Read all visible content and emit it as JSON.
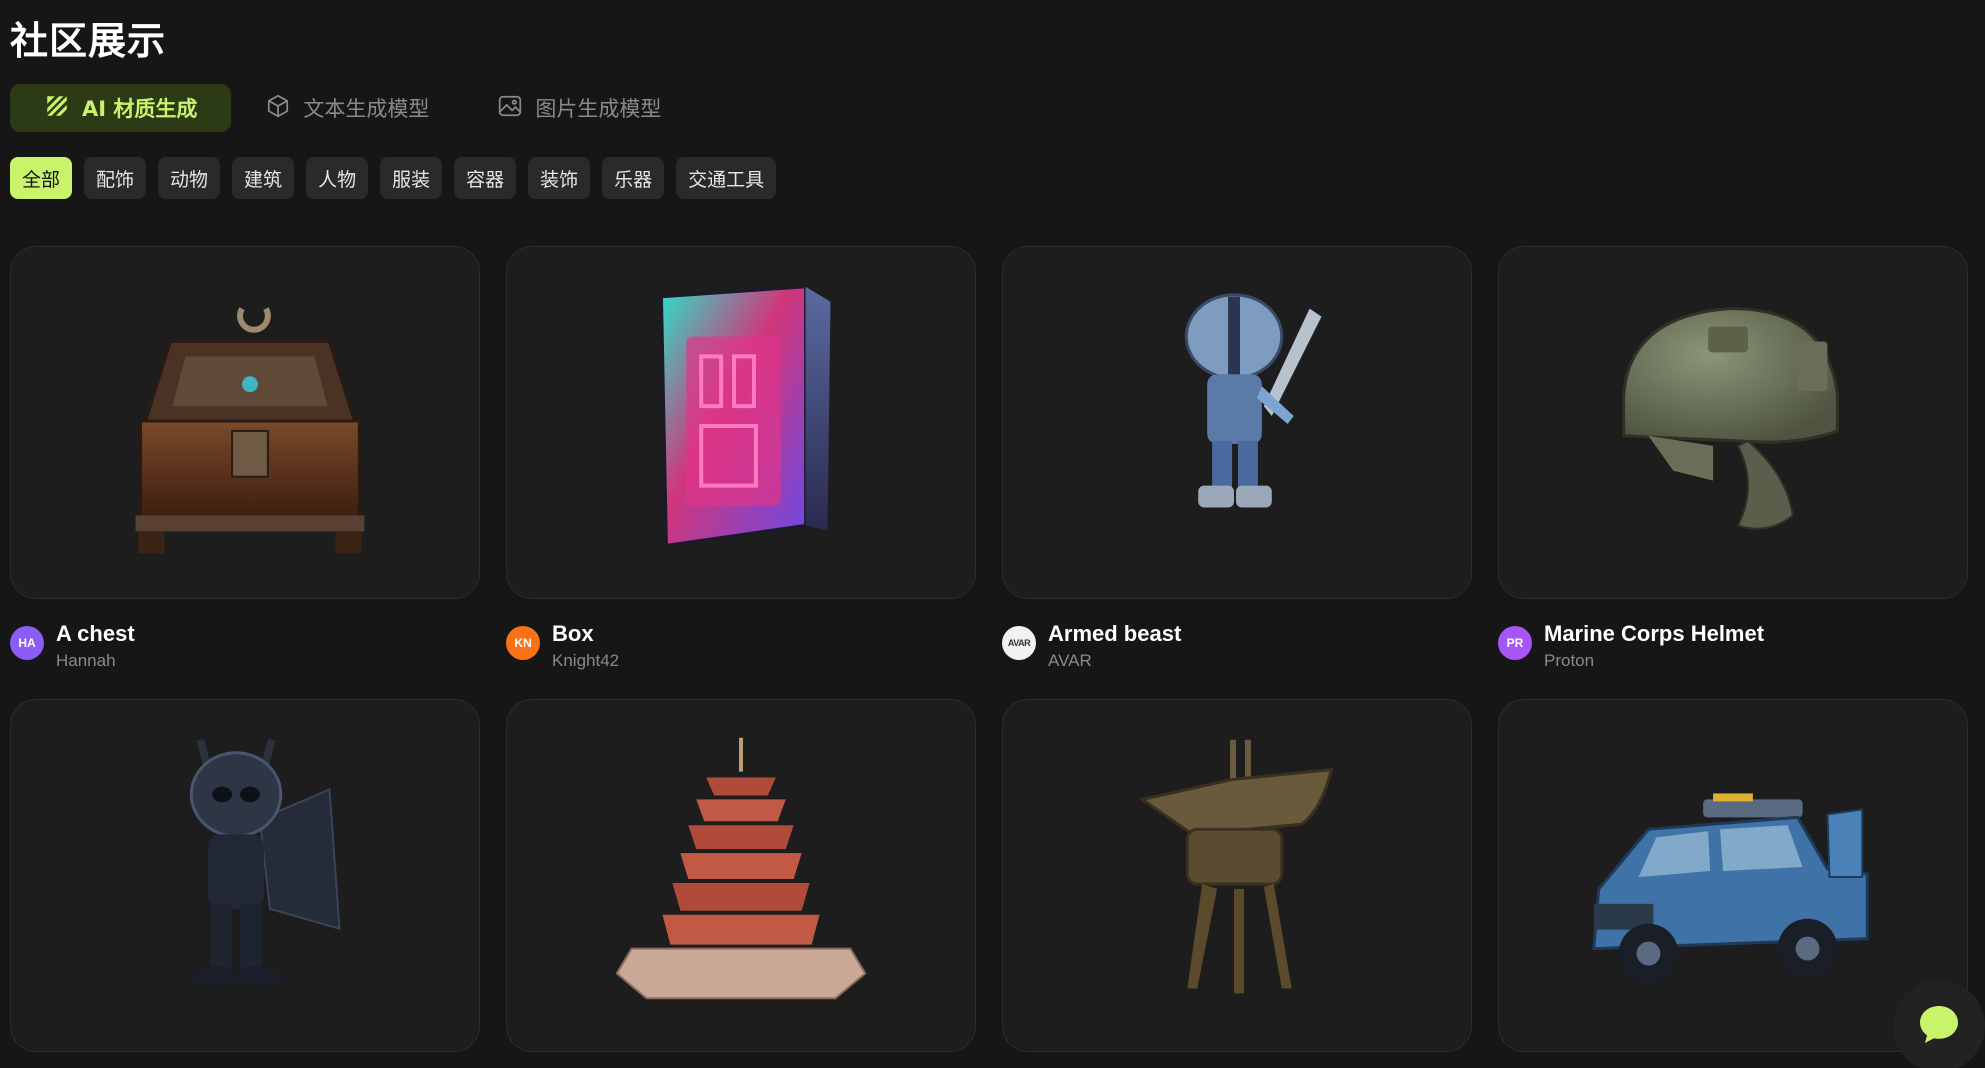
{
  "page": {
    "title": "社区展示"
  },
  "mode_tabs": [
    {
      "label": "AI 材质生成",
      "icon": "texture-brush-icon",
      "active": true
    },
    {
      "label": "文本生成模型",
      "icon": "cube-icon",
      "active": false
    },
    {
      "label": "图片生成模型",
      "icon": "image-icon",
      "active": false
    }
  ],
  "filters": [
    {
      "label": "全部",
      "active": true
    },
    {
      "label": "配饰",
      "active": false
    },
    {
      "label": "动物",
      "active": false
    },
    {
      "label": "建筑",
      "active": false
    },
    {
      "label": "人物",
      "active": false
    },
    {
      "label": "服装",
      "active": false
    },
    {
      "label": "容器",
      "active": false
    },
    {
      "label": "装饰",
      "active": false
    },
    {
      "label": "乐器",
      "active": false
    },
    {
      "label": "交通工具",
      "active": false
    }
  ],
  "cards": [
    {
      "title": "A chest",
      "author": "Hannah",
      "avatar": "HA",
      "avatar_color": "#8b5cf6",
      "thumbnail": "treasure-chest"
    },
    {
      "title": "Box",
      "author": "Knight42",
      "avatar": "KN",
      "avatar_color": "#f97316",
      "thumbnail": "neon-box"
    },
    {
      "title": "Armed beast",
      "author": "AVAR",
      "avatar": "AVAR",
      "avatar_color": "#f2f2f2",
      "thumbnail": "robot-figure"
    },
    {
      "title": "Marine Corps Helmet",
      "author": "Proton",
      "avatar": "PR",
      "avatar_color": "#a855f7",
      "thumbnail": "military-helmet"
    },
    {
      "title": "",
      "author": "",
      "avatar": "",
      "thumbnail": "dark-dragon-figure"
    },
    {
      "title": "",
      "author": "",
      "avatar": "",
      "thumbnail": "pagoda"
    },
    {
      "title": "",
      "author": "",
      "avatar": "",
      "thumbnail": "bronze-vessel"
    },
    {
      "title": "",
      "author": "",
      "avatar": "",
      "thumbnail": "blue-suv"
    }
  ],
  "colors": {
    "accent": "#c8f36a",
    "background": "#161616",
    "card": "#1d1d1d",
    "chip": "#2a2a2a"
  },
  "chat_button": {
    "icon": "chat-bubble-icon"
  }
}
